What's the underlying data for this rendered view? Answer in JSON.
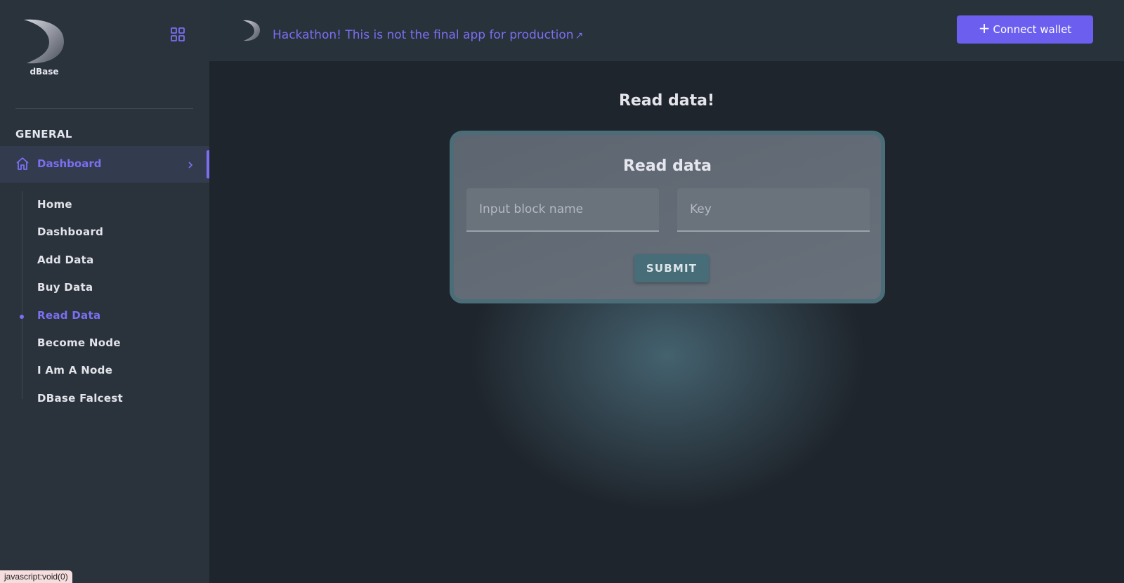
{
  "brand": {
    "name": "dBase"
  },
  "sidebar": {
    "section_title": "GENERAL",
    "active_group": {
      "label": "Dashboard",
      "icon": "home-icon"
    },
    "items": [
      {
        "label": "Home",
        "active": false
      },
      {
        "label": "Dashboard",
        "active": false
      },
      {
        "label": "Add Data",
        "active": false
      },
      {
        "label": "Buy Data",
        "active": false
      },
      {
        "label": "Read Data",
        "active": true
      },
      {
        "label": "Become Node",
        "active": false
      },
      {
        "label": "I Am A Node",
        "active": false
      },
      {
        "label": "DBase Falcest",
        "active": false
      }
    ]
  },
  "header": {
    "banner": "Hackathon! This is not the final app for production",
    "banner_arrow": "↗",
    "connect_label": "Connect wallet",
    "connect_icon": "+"
  },
  "main": {
    "page_title": "Read data!",
    "card_title": "Read data",
    "block_placeholder": "Input block name",
    "key_placeholder": "Key",
    "submit_label": "SUBMIT"
  },
  "status_bar": {
    "text": "javascript:void(0)"
  },
  "colors": {
    "accent": "#7b6ff0",
    "button": "#6c5ff0",
    "submit": "#476d78"
  }
}
